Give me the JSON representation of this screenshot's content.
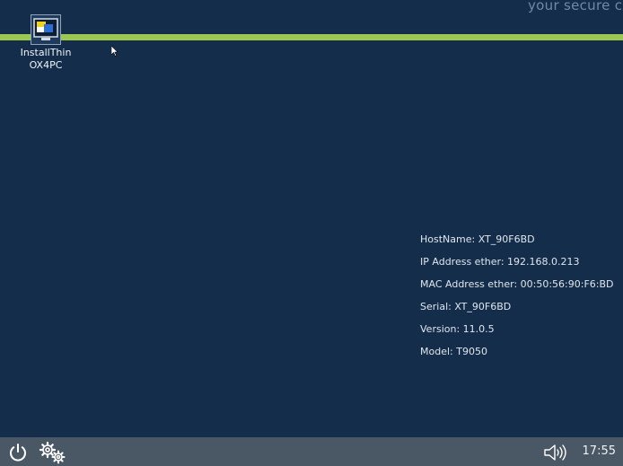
{
  "desktop": {
    "tagline": "your secure c",
    "icons": [
      {
        "label": "InstallThinOX4PC",
        "icon": "monitor-installer-icon"
      }
    ]
  },
  "system_info": {
    "hostname": "HostName:  XT_90F6BD",
    "ip": "IP Address ether: 192.168.0.213",
    "mac": "MAC Address ether: 00:50:56:90:F6:BD",
    "serial": "Serial:  XT_90F6BD",
    "version": "Version:  11.0.5",
    "model": "Model:  T9050"
  },
  "taskbar": {
    "power_icon": "power-icon",
    "settings_icon": "gear-icon",
    "volume_icon": "speaker-icon",
    "clock": "17:55"
  },
  "colors": {
    "background": "#142d4a",
    "accent_bar": "#9cc852",
    "taskbar": "#4a5765"
  }
}
